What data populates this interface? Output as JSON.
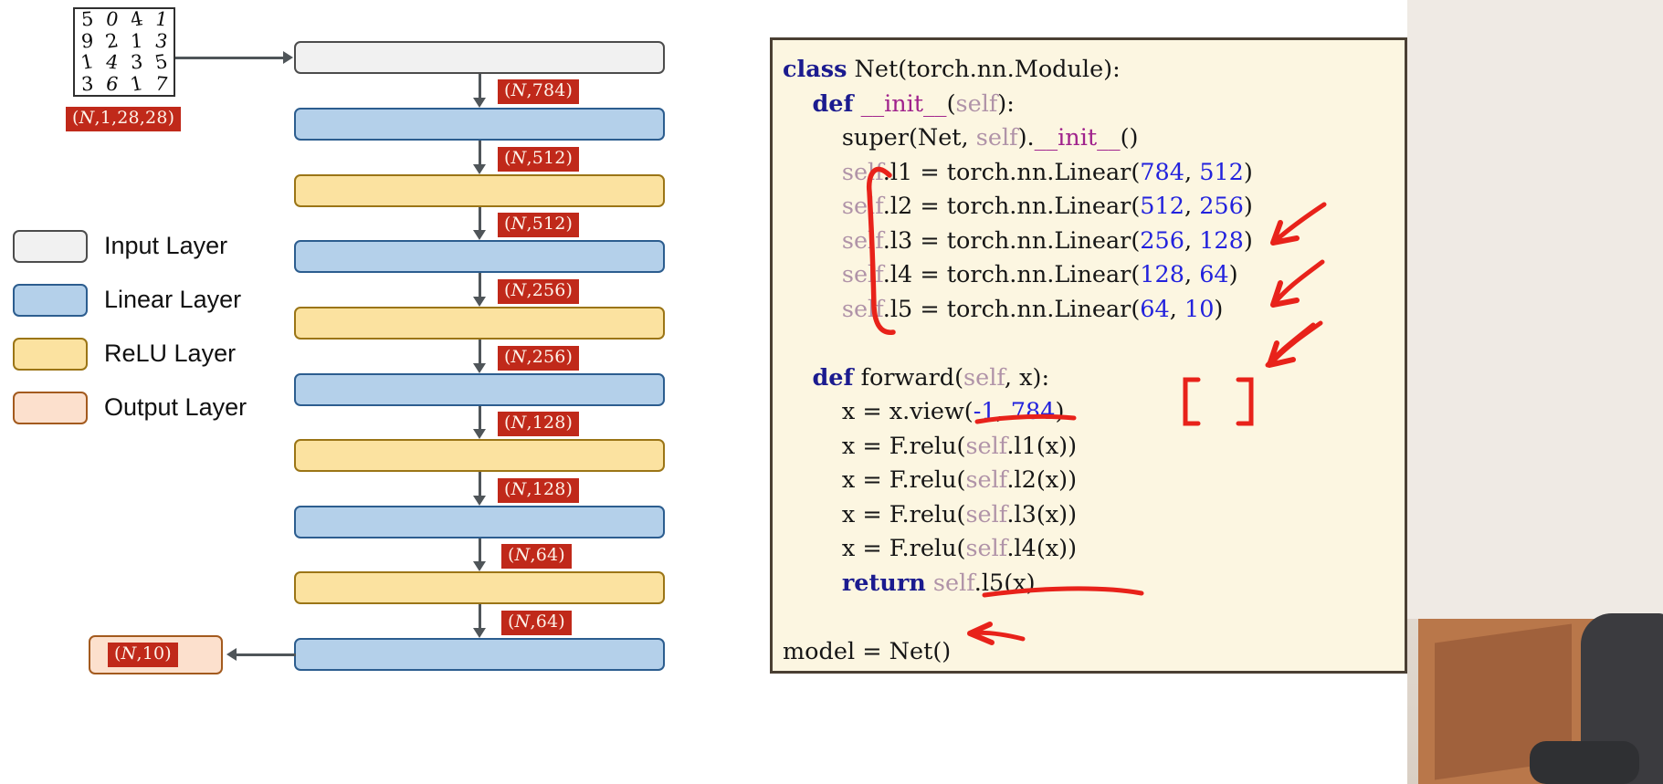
{
  "diagram": {
    "mnist_thumbnail": {
      "name": "mnist-digit-grid",
      "digits": [
        "5",
        "0",
        "4",
        "1",
        "9",
        "2",
        "1",
        "3",
        "1",
        "4",
        "3",
        "5",
        "3",
        "6",
        "1",
        "7"
      ]
    },
    "input_shape_tag": "(N,1,28,28)",
    "layers": [
      {
        "type": "input",
        "name": "input-layer-block",
        "shape_out": "(N,784)"
      },
      {
        "type": "linear",
        "name": "linear-layer-1-block",
        "shape_out": "(N,512)"
      },
      {
        "type": "relu",
        "name": "relu-layer-1-block",
        "shape_out": "(N,512)"
      },
      {
        "type": "linear",
        "name": "linear-layer-2-block",
        "shape_out": "(N,256)"
      },
      {
        "type": "relu",
        "name": "relu-layer-2-block",
        "shape_out": "(N,256)"
      },
      {
        "type": "linear",
        "name": "linear-layer-3-block",
        "shape_out": "(N,128)"
      },
      {
        "type": "relu",
        "name": "relu-layer-3-block",
        "shape_out": "(N,128)"
      },
      {
        "type": "linear",
        "name": "linear-layer-4-block",
        "shape_out": "(N,64)"
      },
      {
        "type": "relu",
        "name": "relu-layer-4-block",
        "shape_out": "(N,64)"
      },
      {
        "type": "linear",
        "name": "linear-layer-5-block",
        "shape_out": ""
      }
    ],
    "output_shape_tag": "(N,10)",
    "legend": [
      {
        "label": "Input Layer",
        "swatch": "sw-input",
        "color": "#f1f1f1",
        "border": "#4c4c4c"
      },
      {
        "label": "Linear Layer",
        "swatch": "sw-linear",
        "color": "#b4d0ea",
        "border": "#2c5d8f"
      },
      {
        "label": "ReLU Layer",
        "swatch": "sw-relu",
        "color": "#fbe2a0",
        "border": "#9b7516"
      },
      {
        "label": "Output Layer",
        "swatch": "sw-output",
        "color": "#fce0cd",
        "border": "#a35a1e"
      }
    ]
  },
  "code_panel": {
    "background_color": "#fcf6e1",
    "border_color": "#4a3f33",
    "lines": [
      "class Net(torch.nn.Module):",
      "    def __init__(self):",
      "        super(Net, self).__init__()",
      "        self.l1 = torch.nn.Linear(784, 512)",
      "        self.l2 = torch.nn.Linear(512, 256)",
      "        self.l3 = torch.nn.Linear(256, 128)",
      "        self.l4 = torch.nn.Linear(128, 64)",
      "        self.l5 = torch.nn.Linear(64, 10)",
      "",
      "    def forward(self, x):",
      "        x = x.view(-1, 784)",
      "        x = F.relu(self.l1(x))",
      "        x = F.relu(self.l2(x))",
      "        x = F.relu(self.l3(x))",
      "        x = F.relu(self.l4(x))",
      "        return self.l5(x)",
      "",
      "model = Net()"
    ],
    "annotations": [
      {
        "name": "red-brace-linear-layers",
        "kind": "brace"
      },
      {
        "name": "red-arrow-512-to-512",
        "kind": "arrow"
      },
      {
        "name": "red-arrow-256-to-256",
        "kind": "arrow"
      },
      {
        "name": "red-arrow-128-to-128",
        "kind": "arrow"
      },
      {
        "name": "red-arrow-64-to-64",
        "kind": "arrow"
      },
      {
        "name": "red-underline-view",
        "kind": "underline"
      },
      {
        "name": "red-brackets-view-line",
        "kind": "brackets"
      },
      {
        "name": "red-underline-return",
        "kind": "underline"
      },
      {
        "name": "red-arrow-model",
        "kind": "arrow"
      }
    ],
    "syntax_colors": {
      "keyword": "#1b1b8f",
      "dunder": "#a0228c",
      "self": "#b093a8",
      "number": "#2222dd",
      "plain": "#161616",
      "annotation": "#e8221a"
    }
  }
}
